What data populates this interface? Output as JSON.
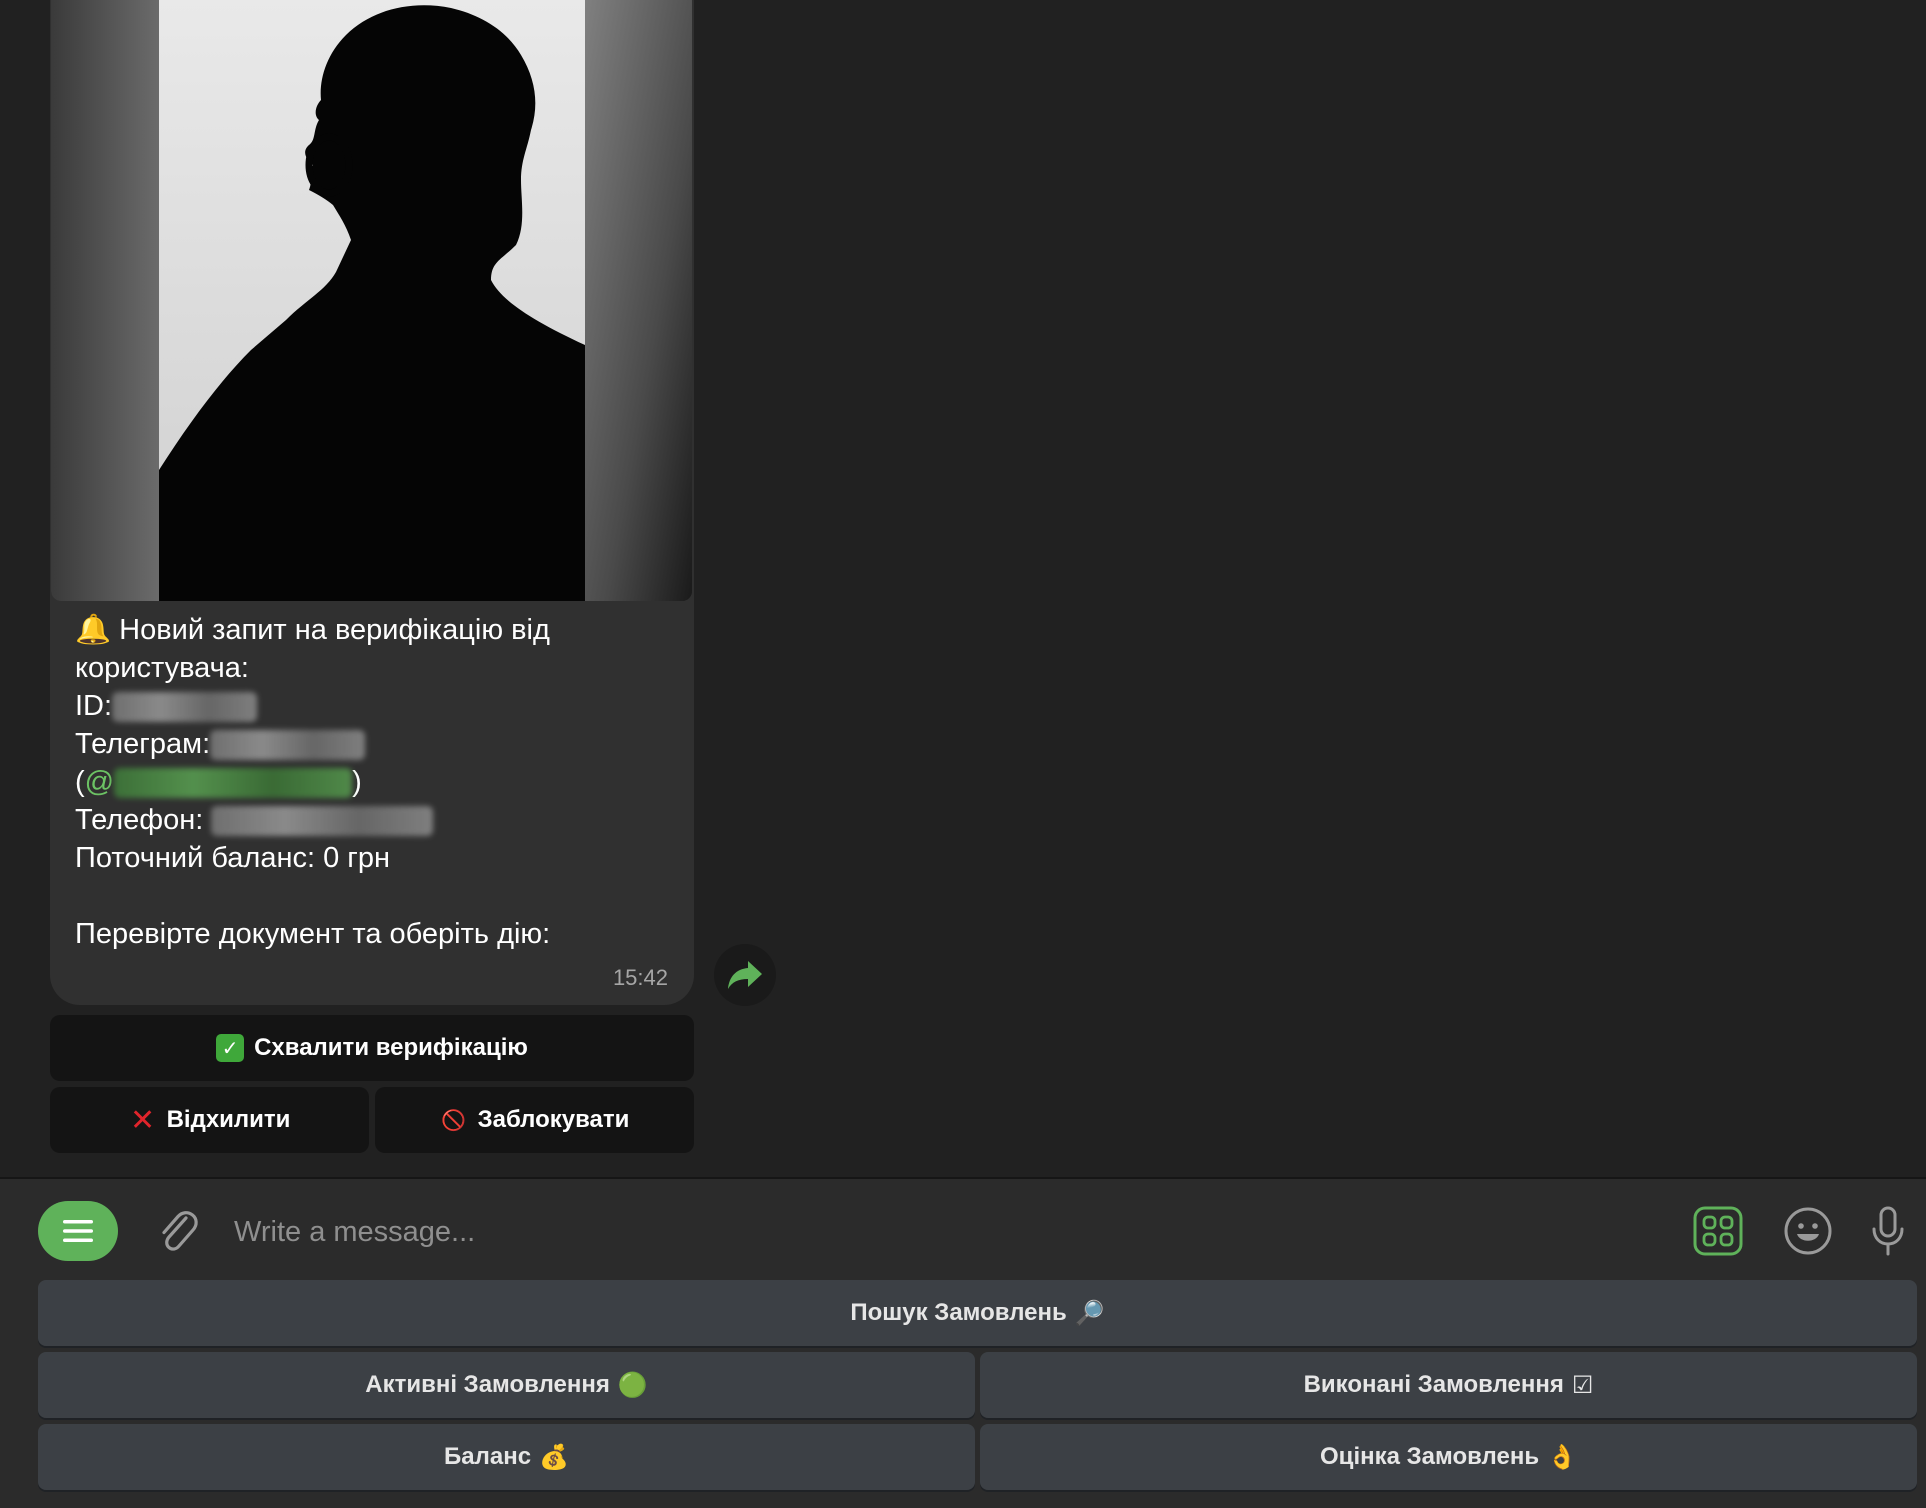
{
  "message": {
    "header_emoji": "🔔",
    "line1": "Новий запит на верифікацію від",
    "line2": "користувача:",
    "id_label": "ID:",
    "telegram_label": "Телеграм:",
    "telegram_open": "(",
    "telegram_at": "@",
    "telegram_close": ")",
    "phone_label": "Телефон:",
    "balance_line": "Поточний баланс: 0 грн",
    "action_line": "Перевірте документ та оберіть дію:",
    "time": "15:42"
  },
  "inline_buttons": {
    "approve_emoji": "✓",
    "approve_label": "Схвалити верифікацію",
    "reject_emoji": "✕",
    "reject_label": "Відхилити",
    "block_emoji": "🚫",
    "block_label": "Заблокувати"
  },
  "composer": {
    "placeholder": "Write a message..."
  },
  "keyboard": {
    "search_label": "Пошук Замовлень",
    "search_emoji": "🔎",
    "active_label": "Активні Замовлення",
    "active_emoji": "🟢",
    "done_label": "Виконані Замовлення",
    "done_emoji": "☑",
    "balance_label": "Баланс",
    "balance_emoji": "💰",
    "rating_label": "Оцінка Замовлень",
    "rating_emoji": "👌"
  },
  "colors": {
    "accent": "#5fb25a",
    "background": "#212121",
    "bubble": "#303030",
    "keyboard_button": "#3c4045"
  }
}
